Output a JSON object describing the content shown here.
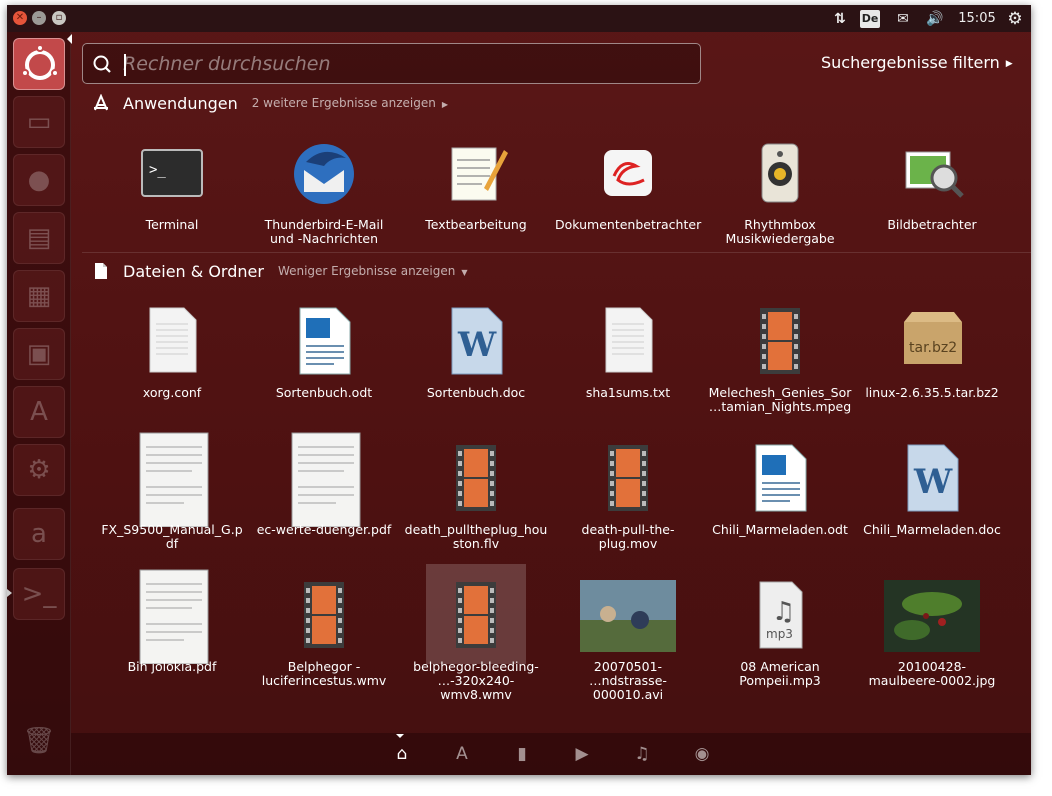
{
  "panel": {
    "window_buttons": [
      "close",
      "minimize",
      "maximize"
    ],
    "keyboard_layout": "De",
    "clock": "15:05",
    "icons": [
      "network-icon",
      "keyboard-layout-icon",
      "mail-icon",
      "volume-icon",
      "session-gear-icon"
    ]
  },
  "launcher": {
    "items": [
      "dash-home",
      "files",
      "firefox",
      "writer",
      "calc",
      "impress",
      "software-center",
      "settings",
      "amazon",
      "terminal",
      "trash"
    ]
  },
  "search": {
    "placeholder": "Rechner durchsuchen",
    "value": ""
  },
  "filter": {
    "label": "Suchergebnisse filtern"
  },
  "apps": {
    "title": "Anwendungen",
    "more": "2 weitere Ergebnisse anzeigen",
    "items": [
      {
        "label": "Terminal",
        "icon": "terminal-icon"
      },
      {
        "label": "Thunderbird-E-Mail\nund -Nachrichten",
        "icon": "thunderbird-icon"
      },
      {
        "label": "Textbearbeitung",
        "icon": "text-editor-icon"
      },
      {
        "label": "Dokumentenbetrachter",
        "icon": "document-viewer-icon"
      },
      {
        "label": "Rhythmbox\nMusikwiedergabe",
        "icon": "rhythmbox-icon"
      },
      {
        "label": "Bildbetrachter",
        "icon": "image-viewer-icon"
      }
    ]
  },
  "files": {
    "title": "Dateien & Ordner",
    "more": "Weniger Ergebnisse anzeigen",
    "items": [
      {
        "label": "xorg.conf",
        "icon": "text-file-icon"
      },
      {
        "label": "Sortenbuch.odt",
        "icon": "odt-file-icon"
      },
      {
        "label": "Sortenbuch.doc",
        "icon": "doc-file-icon"
      },
      {
        "label": "sha1sums.txt",
        "icon": "text-file-icon"
      },
      {
        "label": "Melechesh_Genies_Sor\n…tamian_Nights.mpeg",
        "icon": "video-file-icon"
      },
      {
        "label": "linux-2.6.35.5.tar.bz2",
        "icon": "archive-file-icon"
      },
      {
        "label": "FX_S9500_Manual_G.p\ndf",
        "icon": "pdf-thumbnail"
      },
      {
        "label": "ec-werte-duenger.pdf",
        "icon": "pdf-thumbnail"
      },
      {
        "label": "death_pulltheplug_hou\nston.flv",
        "icon": "video-file-icon"
      },
      {
        "label": "death-pull-the-\nplug.mov",
        "icon": "video-file-icon"
      },
      {
        "label": "Chili_Marmeladen.odt",
        "icon": "odt-file-icon"
      },
      {
        "label": "Chili_Marmeladen.doc",
        "icon": "doc-file-icon"
      },
      {
        "label": "Bih jolokia.pdf",
        "icon": "pdf-thumbnail"
      },
      {
        "label": "Belphegor -\nluciferincestus.wmv",
        "icon": "video-file-icon"
      },
      {
        "label": "belphegor-bleeding-\n…-320x240-wmv8.wmv",
        "icon": "video-file-icon"
      },
      {
        "label": "20070501-\n…ndstrasse-000010.avi",
        "icon": "video-thumbnail"
      },
      {
        "label": "08 American\nPompeii.mp3",
        "icon": "audio-file-icon"
      },
      {
        "label": "20100428-\nmaulbeere-0002.jpg",
        "icon": "image-thumbnail"
      }
    ]
  },
  "lenses": [
    "home-lens-icon",
    "apps-lens-icon",
    "files-lens-icon",
    "video-lens-icon",
    "music-lens-icon",
    "photo-lens-icon"
  ]
}
